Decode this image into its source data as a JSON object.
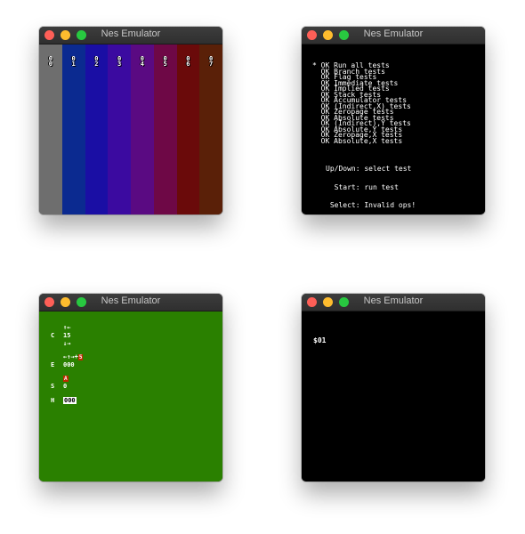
{
  "windows": [
    {
      "title": "Nes Emulator"
    },
    {
      "title": "Nes Emulator"
    },
    {
      "title": "Nes Emulator"
    },
    {
      "title": "Nes Emulator"
    }
  ],
  "palette": {
    "columns": [
      {
        "label_top": "0",
        "label_bottom": "0",
        "color": "#6e6e6e"
      },
      {
        "label_top": "0",
        "label_bottom": "1",
        "color": "#0b2a90"
      },
      {
        "label_top": "0",
        "label_bottom": "2",
        "color": "#1a0ea4"
      },
      {
        "label_top": "0",
        "label_bottom": "3",
        "color": "#3b0aa0"
      },
      {
        "label_top": "0",
        "label_bottom": "4",
        "color": "#5a0a82"
      },
      {
        "label_top": "0",
        "label_bottom": "5",
        "color": "#6e0846"
      },
      {
        "label_top": "0",
        "label_bottom": "6",
        "color": "#6a0a0a"
      },
      {
        "label_top": "0",
        "label_bottom": "7",
        "color": "#5a2008"
      }
    ]
  },
  "tests": {
    "cursor": "*",
    "items": [
      {
        "status": "OK",
        "name": "Run all tests"
      },
      {
        "status": "OK",
        "name": "Branch tests"
      },
      {
        "status": "OK",
        "name": "Flag tests"
      },
      {
        "status": "OK",
        "name": "Immediate tests"
      },
      {
        "status": "OK",
        "name": "Implied tests"
      },
      {
        "status": "OK",
        "name": "Stack tests"
      },
      {
        "status": "OK",
        "name": "Accumulator tests"
      },
      {
        "status": "OK",
        "name": "(Indirect,X) tests"
      },
      {
        "status": "OK",
        "name": "Zeropage tests"
      },
      {
        "status": "OK",
        "name": "Absolute tests"
      },
      {
        "status": "OK",
        "name": "(Indirect),Y tests"
      },
      {
        "status": "OK",
        "name": "Absolute,Y tests"
      },
      {
        "status": "OK",
        "name": "Zeropage,X tests"
      },
      {
        "status": "OK",
        "name": "Absolute,X tests"
      }
    ],
    "help": [
      "Up/Down: select test",
      "  Start: run test",
      " Select: Invalid ops!"
    ]
  },
  "green": {
    "c_label": "C",
    "c_arrows_top": "↑←",
    "c_value": "15",
    "c_arrows_bottom": "↓→",
    "e_arrows": "←↑→+",
    "e_badge": "5",
    "e_label": "E",
    "e_value": "000",
    "s_badge": "A",
    "s_label": "S",
    "s_value": "0",
    "h_label": "H",
    "h_value": "000"
  },
  "black": {
    "text": "$01"
  }
}
